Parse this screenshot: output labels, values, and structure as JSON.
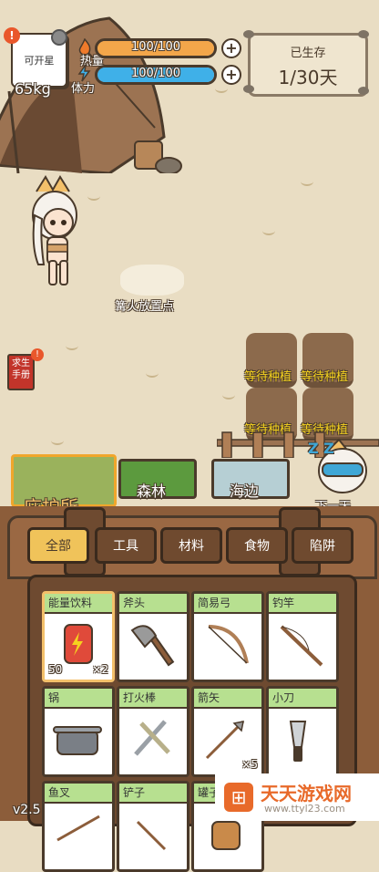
{
  "player": {
    "weight": "65kg",
    "box_label": "可开星",
    "alert": "!"
  },
  "stats": [
    {
      "label": "热量",
      "value_text": "100/100",
      "fill": 1.0,
      "color": "#f3a64a"
    },
    {
      "label": "体力",
      "value_text": "100/100",
      "fill": 1.0,
      "color": "#3fb0e8"
    }
  ],
  "survival": {
    "title": "已生存",
    "days": "1/30天"
  },
  "campfire": {
    "label": "篝火放置点"
  },
  "plots": {
    "label": "等待种植"
  },
  "manual": {
    "label": "求生手册"
  },
  "locations": [
    {
      "label": "庇护所",
      "active": true
    },
    {
      "label": "森林",
      "active": false
    },
    {
      "label": "海边",
      "active": false
    }
  ],
  "next_day": {
    "label": "下一天",
    "zzz": "Z Z"
  },
  "tabs": [
    "全部",
    "工具",
    "材料",
    "食物",
    "陷阱"
  ],
  "items": [
    {
      "name": "能量饮料",
      "count": "×2",
      "value": "50",
      "icon": "energy-drink-icon"
    },
    {
      "name": "斧头",
      "count": "",
      "value": "",
      "icon": "axe-icon"
    },
    {
      "name": "简易弓",
      "count": "",
      "value": "",
      "icon": "bow-icon"
    },
    {
      "name": "钓竿",
      "count": "",
      "value": "",
      "icon": "fishing-rod-icon"
    },
    {
      "name": "锅",
      "count": "",
      "value": "",
      "icon": "pot-icon"
    },
    {
      "name": "打火棒",
      "count": "",
      "value": "",
      "icon": "fire-starter-icon"
    },
    {
      "name": "箭矢",
      "count": "×5",
      "value": "",
      "icon": "arrow-icon"
    },
    {
      "name": "小刀",
      "count": "",
      "value": "",
      "icon": "knife-icon"
    },
    {
      "name": "鱼叉",
      "count": "",
      "value": "",
      "icon": "harpoon-icon"
    },
    {
      "name": "铲子",
      "count": "",
      "value": "",
      "icon": "shovel-icon"
    },
    {
      "name": "罐子",
      "count": "",
      "value": "",
      "icon": "jar-icon"
    }
  ],
  "version": "v2.5",
  "watermark": {
    "title": "天天游戏网",
    "url": "www.ttyl23.com"
  }
}
